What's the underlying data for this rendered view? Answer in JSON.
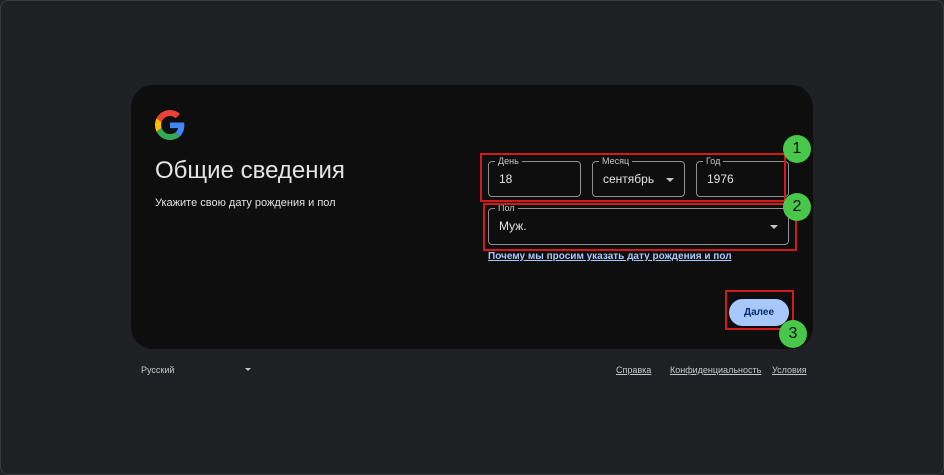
{
  "card": {
    "title": "Общие сведения",
    "subtitle": "Укажите свою дату рождения и пол"
  },
  "birthdate": {
    "day": {
      "label": "День",
      "value": "18"
    },
    "month": {
      "label": "Месяц",
      "value": "сентябрь"
    },
    "year": {
      "label": "Год",
      "value": "1976"
    }
  },
  "gender": {
    "label": "Пол",
    "value": "Муж."
  },
  "why_link": "Почему мы просим указать дату рождения и пол",
  "next_button": "Далее",
  "annotations": [
    "1",
    "2",
    "3"
  ],
  "footer": {
    "language": "Русский",
    "links": {
      "help": "Справка",
      "privacy": "Конфиденциальность",
      "terms": "Условия"
    }
  },
  "colors": {
    "background": "#1f2023",
    "card": "#0e0e0e",
    "accent": "#a8c7fa",
    "highlight": "#d11a1a",
    "badge": "#48c74a"
  },
  "icons": {
    "logo": "google-logo",
    "dropdown": "caret-down-icon"
  }
}
